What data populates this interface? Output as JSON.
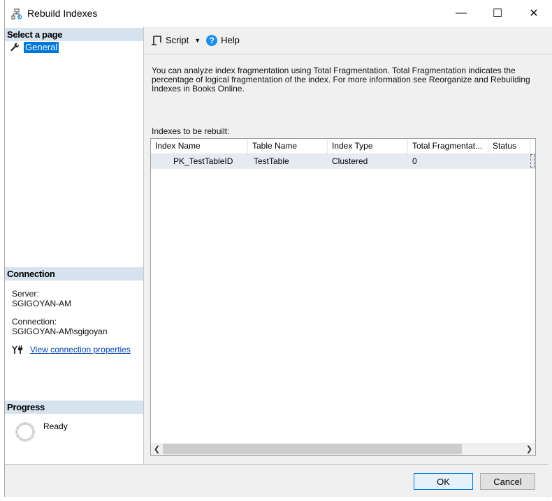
{
  "window": {
    "title": "Rebuild Indexes",
    "controls": {
      "minimize": "—",
      "maximize": "☐",
      "close": "✕"
    }
  },
  "sidebar": {
    "select_page_header": "Select a page",
    "pages": [
      {
        "label": "General",
        "icon": "wrench-icon",
        "selected": true
      }
    ],
    "connection_header": "Connection",
    "server_label": "Server:",
    "server_value": "SGIGOYAN-AM",
    "connection_label": "Connection:",
    "connection_value": "SGIGOYAN-AM\\sgigoyan",
    "view_connection_link": "View connection properties",
    "progress_header": "Progress",
    "progress_status": "Ready"
  },
  "toolbar": {
    "script_label": "Script",
    "help_label": "Help"
  },
  "main": {
    "description": "You can analyze index fragmentation using Total Fragmentation. Total Fragmentation indicates the percentage of logical fragmentation of the index. For more information see Reorganize and Rebuilding Indexes in Books Online.",
    "list_label": "Indexes to be rebuilt:",
    "columns": [
      "Index Name",
      "Table Name",
      "Index Type",
      "Total Fragmentat...",
      "Status"
    ],
    "rows": [
      {
        "index_name": "PK_TestTableID",
        "table_name": "TestTable",
        "index_type": "Clustered",
        "total_fragmentation": "0",
        "status": ""
      }
    ]
  },
  "footer": {
    "ok_label": "OK",
    "cancel_label": "Cancel"
  },
  "colors": {
    "selection": "#0078d7",
    "header_band": "#d6e2ee",
    "row_highlight": "#e6ebf1",
    "link": "#0645ad",
    "help_icon": "#1e8ee6"
  }
}
